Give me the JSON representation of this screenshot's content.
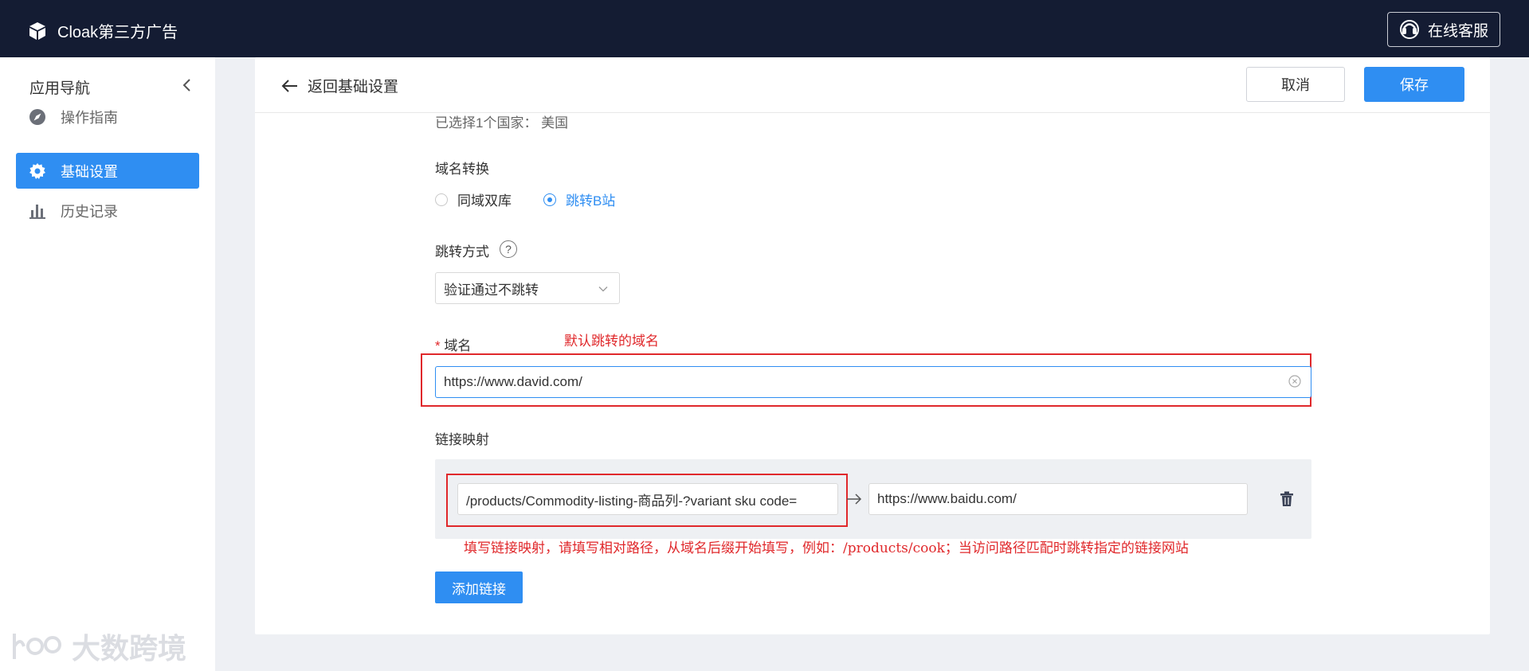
{
  "app": {
    "title": "Cloak第三方广告"
  },
  "header": {
    "support_label": "在线客服"
  },
  "sidebar": {
    "title": "应用导航",
    "items": [
      {
        "label": "操作指南",
        "icon": "compass-icon"
      },
      {
        "label": "基础设置",
        "icon": "gear-icon",
        "active": true
      },
      {
        "label": "历史记录",
        "icon": "bar-chart-icon"
      }
    ]
  },
  "toolbar": {
    "back_label": "返回基础设置",
    "cancel_label": "取消",
    "save_label": "保存"
  },
  "form": {
    "selected_countries": "已选择1个国家：   美国",
    "domain_switch": {
      "label": "域名转换",
      "options": [
        {
          "label": "同域双库",
          "checked": false
        },
        {
          "label": "跳转B站",
          "checked": true
        }
      ]
    },
    "redirect_mode": {
      "label": "跳转方式",
      "help": "?",
      "value": "验证通过不跳转"
    },
    "domain": {
      "required_mark": "*",
      "label": "域名",
      "value": "https://www.david.com/"
    },
    "link_mapping": {
      "label": "链接映射",
      "rows": [
        {
          "source": "/products/Commodity-listing-商品列-?variant sku code=",
          "target": "https://www.baidu.com/"
        }
      ]
    },
    "add_link_label": "添加链接"
  },
  "annotations": {
    "domain_note": "默认跳转的域名",
    "mapping_note": "填写链接映射，请填写相对路径，从域名后缀开始填写，例如：/products/cook；当访问路径匹配时跳转指定的链接网站"
  },
  "watermark": {
    "text": "大数跨境"
  },
  "colors": {
    "topbar": "#141c33",
    "accent": "#2f8ef2",
    "annotation": "#e0282b"
  }
}
